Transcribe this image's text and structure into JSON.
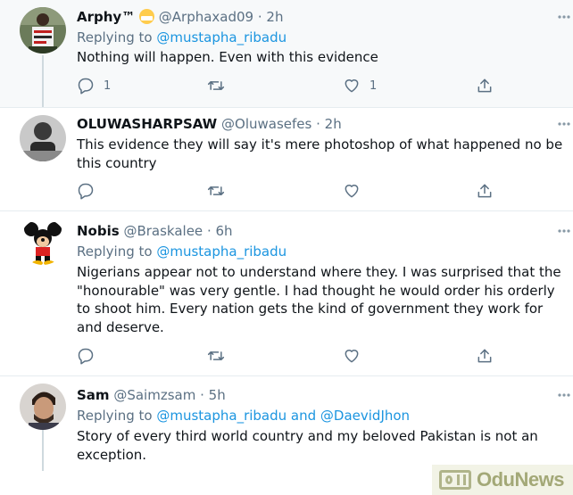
{
  "tweets": [
    {
      "name": "Arphy™",
      "handle": "@Arphaxad09",
      "time": "· 2h",
      "reply_prefix": "Replying to ",
      "reply_to": "@mustapha_ribadu",
      "text": "Nothing will happen. Even with this evidence",
      "reply_count": "1",
      "like_count": "1"
    },
    {
      "name": "OLUWASHARPSAW",
      "handle": "@Oluwasefes",
      "time": "· 2h",
      "text": "This evidence they will say it's mere photoshop of what happened no be this country"
    },
    {
      "name": "Nobis",
      "handle": "@Braskalee",
      "time": "· 6h",
      "reply_prefix": "Replying to ",
      "reply_to": "@mustapha_ribadu",
      "text": "Nigerians appear not to understand where they. I was surprised that the \"honourable\" was very gentle. I had thought he would order his orderly to shoot him. Every nation gets the kind of government they work for and deserve."
    },
    {
      "name": "Sam",
      "handle": "@Saimzsam",
      "time": "· 5h",
      "reply_prefix": "Replying to ",
      "reply_to": "@mustapha_ribadu and @DaevidJhon",
      "text": "Story of every third world country and my beloved Pakistan is not an exception."
    }
  ],
  "watermark": {
    "text": "OduNews"
  },
  "icons": [
    "reply-icon",
    "retweet-icon",
    "like-icon",
    "share-icon",
    "more-icon"
  ],
  "colors": {
    "link": "#1b95e0",
    "muted": "#5b7083",
    "text": "#0f1419",
    "highlight": "#f7f9fa"
  }
}
